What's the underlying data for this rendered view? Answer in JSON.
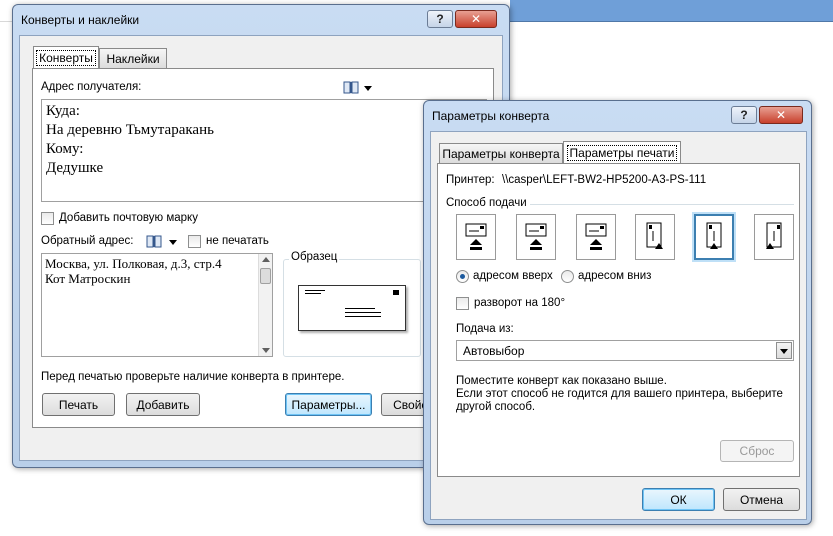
{
  "envelopes_window": {
    "title": "Конверты и наклейки",
    "help": "?",
    "close": "✕",
    "tabs": [
      "Конверты",
      "Наклейки"
    ],
    "recipient_label": "Адрес получателя:",
    "recipient_lines": [
      "Куда:",
      "На деревню Тьмутаракань",
      "Кому:",
      "Дедушке"
    ],
    "add_stamp_label": "Добавить почтовую марку",
    "return_label": "Обратный адрес:",
    "omit_label": "не печатать",
    "return_lines": [
      "Москва, ул. Полковая, д.3, стр.4",
      "Кот Матроскин"
    ],
    "preview_label": "Образец",
    "printer_note": "Перед печатью проверьте наличие конверта в принтере.",
    "buttons": {
      "print": "Печать",
      "add": "Добавить",
      "options": "Параметры...",
      "properties": "Свойства..."
    }
  },
  "options_window": {
    "title": "Параметры конверта",
    "help": "?",
    "close": "✕",
    "tabs": [
      "Параметры конверта",
      "Параметры печати"
    ],
    "printer_label": "Принтер:",
    "printer_value": "\\\\casper\\LEFT-BW2-HP5200-A3-PS-111",
    "feed_method_label": "Способ подачи",
    "face_up_label": "адресом вверх",
    "face_down_label": "адресом вниз",
    "rotate_label": "разворот на 180°",
    "feed_from_label": "Подача из:",
    "feed_from_value": "Автовыбор",
    "instruction_lines": [
      "Поместите конверт как показано выше.",
      "Если этот способ не годится для вашего принтера, выберите",
      "другой способ."
    ],
    "reset_label": "Сброс",
    "ok_label": "ОК",
    "cancel_label": "Отмена",
    "selected_feed_index": 4
  }
}
